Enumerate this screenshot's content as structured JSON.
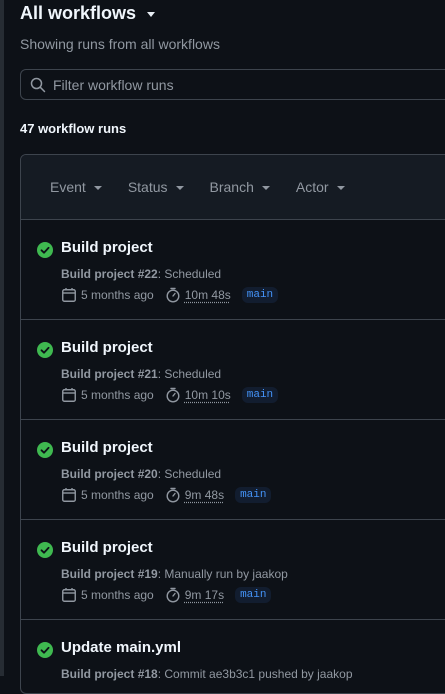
{
  "header": {
    "title": "All workflows",
    "subtitle": "Showing runs from all workflows"
  },
  "search": {
    "placeholder": "Filter workflow runs",
    "value": ""
  },
  "run_count": "47 workflow runs",
  "filters": [
    "Event",
    "Status",
    "Branch",
    "Actor"
  ],
  "runs": [
    {
      "status": "success",
      "title": "Build project",
      "workflow": "Build project",
      "number": "#22",
      "trigger": ": Scheduled",
      "time_ago": "5 months ago",
      "duration": "10m 48s",
      "branch": "main"
    },
    {
      "status": "success",
      "title": "Build project",
      "workflow": "Build project",
      "number": "#21",
      "trigger": ": Scheduled",
      "time_ago": "5 months ago",
      "duration": "10m 10s",
      "branch": "main"
    },
    {
      "status": "success",
      "title": "Build project",
      "workflow": "Build project",
      "number": "#20",
      "trigger": ": Scheduled",
      "time_ago": "5 months ago",
      "duration": "9m 48s",
      "branch": "main"
    },
    {
      "status": "success",
      "title": "Build project",
      "workflow": "Build project",
      "number": "#19",
      "trigger": ": Manually run by jaakop",
      "time_ago": "5 months ago",
      "duration": "9m 17s",
      "branch": "main"
    },
    {
      "status": "success",
      "title": "Update main.yml",
      "workflow": "Build project",
      "number": "#18",
      "trigger": ": Commit ae3b3c1 pushed by jaakop",
      "time_ago": "",
      "duration": "",
      "branch": ""
    }
  ],
  "colors": {
    "background": "#0d1117",
    "success": "#3fb950",
    "link": "#4493f8",
    "border": "#3d444d"
  }
}
